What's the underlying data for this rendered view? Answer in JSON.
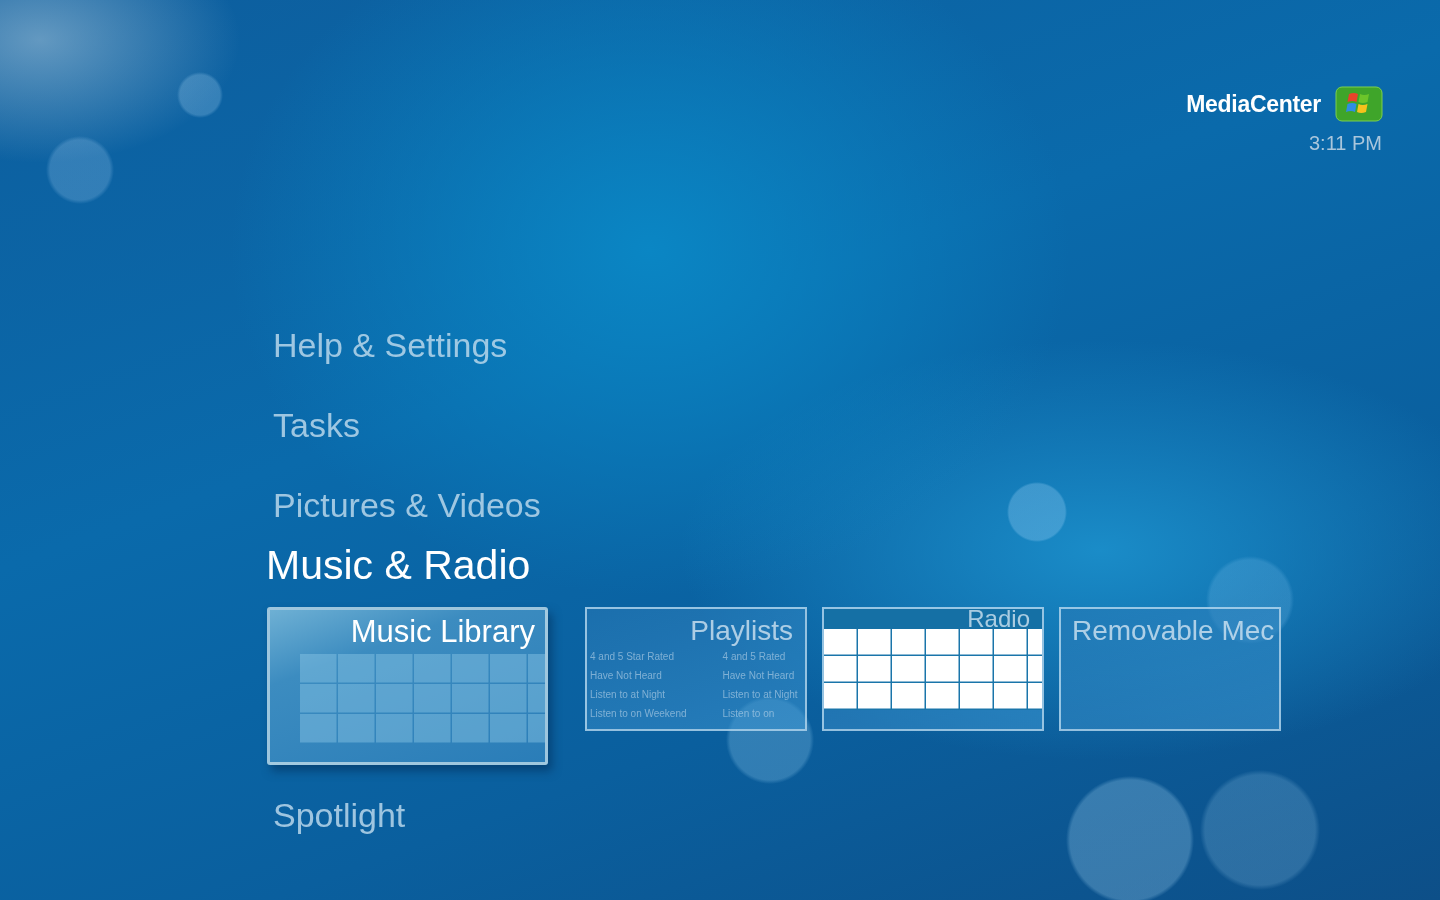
{
  "header": {
    "brand": "MediaCenter",
    "time": "3:11 PM"
  },
  "menu": [
    {
      "label": "Help & Settings",
      "selected": false
    },
    {
      "label": "Tasks",
      "selected": false
    },
    {
      "label": "Pictures & Videos",
      "selected": false
    },
    {
      "label": "Music & Radio",
      "selected": true,
      "tiles": [
        {
          "kind": "library",
          "title": "Music Library",
          "selected": true
        },
        {
          "kind": "playlists",
          "title": "Playlists",
          "selected": false,
          "items": [
            "4 and 5 Star Rated",
            "Have Not Heard",
            "Listen to at Night",
            "Listen to on Weekend"
          ],
          "items_2": [
            "4 and 5  Rated",
            "Have Not Heard",
            "Listen to at Night",
            "Listen to on"
          ]
        },
        {
          "kind": "radio",
          "title": "Radio",
          "selected": false
        },
        {
          "kind": "removable",
          "title": "Removable Mec",
          "selected": false
        }
      ]
    },
    {
      "label": "Spotlight",
      "selected": false
    }
  ]
}
